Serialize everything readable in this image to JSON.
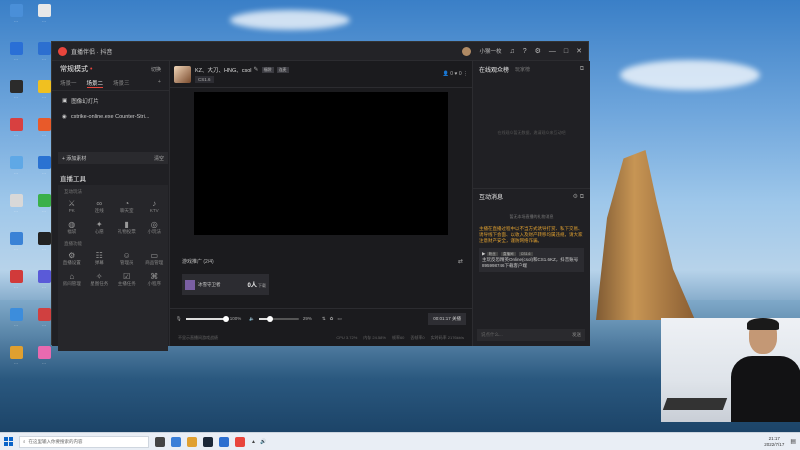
{
  "desktop_icons": [
    {
      "label": "…",
      "color": "#4a8fd8"
    },
    {
      "label": "…",
      "color": "#2a6fd6"
    },
    {
      "label": "…",
      "color": "#2b2b2b"
    },
    {
      "label": "…",
      "color": "#d84040"
    },
    {
      "label": "…",
      "color": "#5fa8e6"
    },
    {
      "label": "…",
      "color": "#d8d8d8"
    },
    {
      "label": "…",
      "color": "#3a82d6"
    },
    {
      "label": "…",
      "color": "#d13a3a"
    },
    {
      "label": "…",
      "color": "#3c8ddc"
    },
    {
      "label": "…",
      "color": "#e0a030"
    },
    {
      "label": "…",
      "color": "#e8e8e8"
    },
    {
      "label": "…",
      "color": "#2c6fd0"
    },
    {
      "label": "…",
      "color": "#f0c020"
    },
    {
      "label": "…",
      "color": "#e85a2a"
    },
    {
      "label": "…",
      "color": "#2a72d2"
    },
    {
      "label": "…",
      "color": "#3bb04a"
    },
    {
      "label": "…",
      "color": "#222"
    },
    {
      "label": "…",
      "color": "#5a5ad8"
    },
    {
      "label": "…",
      "color": "#d04040"
    },
    {
      "label": "…",
      "color": "#e86ab0"
    }
  ],
  "app": {
    "title": "直播伴侣 · 抖音",
    "user_name": "小猴一枚",
    "mode": {
      "label": "常规模式",
      "switch_label": "切换"
    },
    "scenes": [
      "场景一",
      "场景二",
      "场景三"
    ],
    "active_scene": 1,
    "sources": [
      {
        "icon": "image-icon",
        "label": "图像幻灯片"
      },
      {
        "icon": "game-icon",
        "label": "cstrike-online.exe Counter-Stri..."
      }
    ],
    "add_source_label": "+ 添加素材",
    "clear_label": "清空",
    "tools_title": "直播工具",
    "tool_groups": [
      {
        "title": "互动玩法",
        "items": [
          {
            "label": "PK",
            "icon": "pk-icon",
            "glyph": "⚔"
          },
          {
            "label": "连线",
            "icon": "link-icon",
            "glyph": "∞"
          },
          {
            "label": "聊天室",
            "icon": "chat-room-icon",
            "glyph": "◔"
          },
          {
            "label": "KTV",
            "icon": "ktv-icon",
            "glyph": "♪"
          },
          {
            "label": "福袋",
            "icon": "lucky-bag-icon",
            "glyph": "◍"
          },
          {
            "label": "心愿",
            "icon": "wish-icon",
            "glyph": "✦"
          },
          {
            "label": "礼物投票",
            "icon": "gift-vote-icon",
            "glyph": "▮"
          },
          {
            "label": "小玩法",
            "icon": "mini-game-icon",
            "glyph": "◎"
          }
        ]
      },
      {
        "title": "直播功能",
        "items": [
          {
            "label": "直播设置",
            "icon": "settings-icon",
            "glyph": "⚙"
          },
          {
            "label": "弹幕",
            "icon": "danmaku-icon",
            "glyph": "☷"
          },
          {
            "label": "管理员",
            "icon": "admin-icon",
            "glyph": "☺"
          },
          {
            "label": "商品管理",
            "icon": "goods-icon",
            "glyph": "▭"
          },
          {
            "label": "房间管理",
            "icon": "room-icon",
            "glyph": "⌂"
          },
          {
            "label": "星图任务",
            "icon": "task-icon",
            "glyph": "✧"
          },
          {
            "label": "主播任务",
            "icon": "anchor-task-icon",
            "glyph": "☑"
          },
          {
            "label": "小程序",
            "icon": "miniapp-icon",
            "glyph": "⌘"
          }
        ]
      }
    ],
    "stream": {
      "name": "KZ、大刀、HNG、csol",
      "tag1": "福袋",
      "tag2": "连麦",
      "category": "CS1.6",
      "viewers": "0",
      "likes": "0"
    },
    "promo": {
      "title": "游戏推广 (2/4)",
      "item": "冰雪守卫者",
      "price_value": "0人",
      "price_unit": "下载"
    },
    "controls": {
      "mic_pct": "100%",
      "mic_level": 1.0,
      "spk_pct": "29%",
      "spk_level": 0.29,
      "timer": "00:01:17",
      "end_label": "关播"
    },
    "status": {
      "left": "不显示直播间游戏战绩",
      "cpu": "CPU 3.72%",
      "mem": "内存 24.58%",
      "fps": "帧率60",
      "drop": "丢帧率0",
      "bitrate": "实时码率 2176kb/s"
    },
    "right": {
      "viewers_tab": "在线观众榜",
      "rank_tab": "玩家榜",
      "viewers_empty": "在线观众暂无数据，邀请观众来互动吧",
      "msg_title": "互动消息",
      "msg_tip": "暂无本场直播的礼物消息",
      "system_msg": "主播在直播过程中以不当方式诱导打赏、私下交易、诱导线下会面、以收入及财产转移均属违规，请大家注意财产安全，谨防网络诈骗。",
      "msg_tags": [
        "粉丝",
        "直播间",
        "CS1.6"
      ],
      "msg_text": "主玩反恐精英Online(csol)和CS1.6KZ，抖音账号895998746下载客户端",
      "input_placeholder": "说点什么...",
      "send": "发送"
    }
  },
  "taskbar": {
    "search_placeholder": "在这里输入你要搜索的内容",
    "time": "21:17",
    "date": "2022/7/17"
  }
}
